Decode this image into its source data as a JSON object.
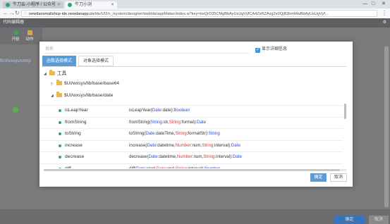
{
  "browser": {
    "tabs": [
      {
        "label": "牛刀云-小程序 / 公众号"
      },
      {
        "label": "牛刀小浏"
      }
    ],
    "window_controls": [
      "—",
      "□",
      "✕"
    ],
    "url_host": "newdaosmallshop-ide.newdaoapp.cn",
    "url_path": "/ide/UI2/v_/system/designer/webIde/appMaker/index.w?key=bxQrO35CMgBbAyUsUgVyfCA4ZxRZAzg2e0QjB3hmMwBbAyUsUgVyf..."
  },
  "app": {
    "header_title": "代码编辑器",
    "tools": [
      {
        "label": "开始",
        "color": "#3aa35a"
      },
      {
        "label": "动作",
        "color": "#e0a53a"
      }
    ],
    "left_path": "$UI/wxsys/comp",
    "bottom_ok": "确定",
    "bottom_cancel": "取消"
  },
  "modal": {
    "search_placeholder": "搜索",
    "show_detail_label": "显示详细信息",
    "show_detail_checked": true,
    "tabs": [
      {
        "label": "函数选择模式",
        "active": true
      },
      {
        "label": "对象选择模式",
        "active": false
      }
    ],
    "tree": {
      "root": "工具",
      "children": [
        {
          "label": "$UI/wxsys/lib/base/base64",
          "expanded": false
        },
        {
          "label": "$UI/wxsys/lib/base/date",
          "expanded": true
        }
      ]
    },
    "methods": [
      {
        "name": "isLeapYear",
        "sig": [
          [
            "isLeapYear(",
            ""
          ],
          [
            "Date",
            "t"
          ],
          [
            ":date):",
            ""
          ],
          [
            "Boolean",
            "t"
          ]
        ]
      },
      {
        "name": "fromString",
        "sig": [
          [
            "fromString(",
            ""
          ],
          [
            "String",
            "t"
          ],
          [
            ":str,",
            ""
          ],
          [
            "String",
            "r"
          ],
          [
            ":format):",
            ""
          ],
          [
            "Date",
            "t"
          ]
        ]
      },
      {
        "name": "toString",
        "sig": [
          [
            "toString(",
            ""
          ],
          [
            "Date",
            "t"
          ],
          [
            ":dateTime,",
            ""
          ],
          [
            "String",
            "r"
          ],
          [
            ":formatStr):",
            ""
          ],
          [
            "String",
            "t"
          ]
        ]
      },
      {
        "name": "increase",
        "sig": [
          [
            "increase(",
            ""
          ],
          [
            "Date",
            "t"
          ],
          [
            ":datetime,",
            ""
          ],
          [
            "Number",
            "r"
          ],
          [
            ":num,",
            ""
          ],
          [
            "String",
            "r"
          ],
          [
            ":interval):",
            ""
          ],
          [
            "Date",
            "t"
          ]
        ]
      },
      {
        "name": "decrease",
        "sig": [
          [
            "decrease(",
            ""
          ],
          [
            "Date",
            "t"
          ],
          [
            ":datetime,",
            ""
          ],
          [
            "Number",
            "r"
          ],
          [
            ":num,",
            ""
          ],
          [
            "String",
            "r"
          ],
          [
            ":interval):",
            ""
          ],
          [
            "Date",
            "t"
          ]
        ]
      },
      {
        "name": "diff",
        "sig": [
          [
            "diff(",
            ""
          ],
          [
            "Date",
            "t"
          ],
          [
            ":start,",
            ""
          ],
          [
            "Date",
            "r"
          ],
          [
            ":end,",
            ""
          ],
          [
            "String",
            "r"
          ],
          [
            ":interval):",
            ""
          ],
          [
            "Number",
            "t"
          ]
        ]
      }
    ],
    "ok_label": "确定",
    "cancel_label": "取消"
  },
  "colors": {
    "accent": "#5b9bd5",
    "type": "#2f4fd1",
    "param": "#d23b3b",
    "method_dot": "#3aa35a"
  }
}
